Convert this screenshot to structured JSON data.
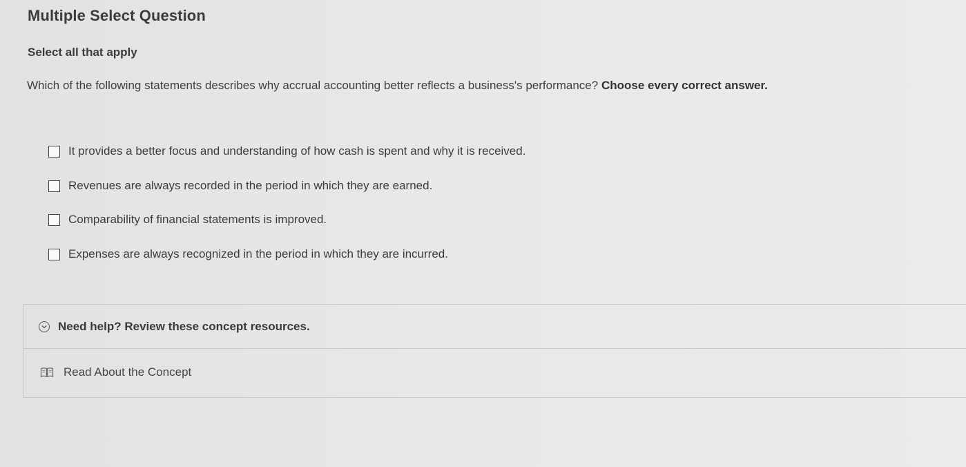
{
  "question": {
    "type_heading": "Multiple Select Question",
    "instruction": "Select all that apply",
    "prompt_text": "Which of the following statements describes why accrual accounting better reflects a business's performance?",
    "prompt_emphasis": "Choose every correct answer."
  },
  "options": [
    {
      "label": "It provides a better focus and understanding of how cash is spent and why it is received.",
      "checked": false
    },
    {
      "label": "Revenues are always recorded in the period in which they are earned.",
      "checked": false
    },
    {
      "label": "Comparability of financial statements is improved.",
      "checked": false
    },
    {
      "label": "Expenses are always recognized in the period in which they are incurred.",
      "checked": false
    }
  ],
  "help": {
    "title": "Need help? Review these concept resources.",
    "toggle_icon": "chevron-down-icon",
    "resources": [
      {
        "label": "Read About the Concept",
        "icon": "book-icon"
      }
    ]
  }
}
